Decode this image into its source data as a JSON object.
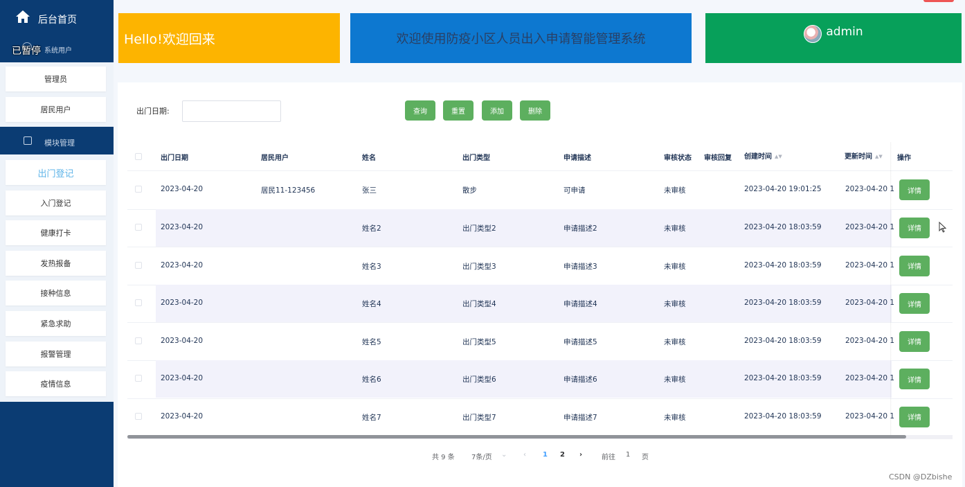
{
  "sidebar": {
    "home_label": "后台首页",
    "paused_label": "已暂停",
    "system_users_label": "系统用户",
    "system_items": [
      "管理员",
      "居民用户"
    ],
    "module_label": "模块管理",
    "module_items": [
      "出门登记",
      "入门登记",
      "健康打卡",
      "发热报备",
      "接种信息",
      "紧急求助",
      "报警管理",
      "疫情信息"
    ],
    "active_item": "出门登记"
  },
  "banners": {
    "welcome": "Hello!欢迎回来",
    "system_title": "欢迎使用防疫小区人员出入申请智能管理系统",
    "user": "admin",
    "colors": {
      "welcome": "#fdb400",
      "title": "#0d78d0",
      "user": "#07a05a"
    }
  },
  "search": {
    "date_label": "出门日期:",
    "date_value": "",
    "buttons": {
      "query": "查询",
      "reset": "重置",
      "add": "添加",
      "delete": "删除"
    }
  },
  "table": {
    "headers": [
      "出门日期",
      "居民用户",
      "姓名",
      "出门类型",
      "申请描述",
      "审核状态",
      "审核回复",
      "创建时间",
      "更新时间",
      "操作"
    ],
    "rows": [
      {
        "date": "2023-04-20",
        "resident": "居民11-123456",
        "name": "张三",
        "type": "散步",
        "desc": "可申请",
        "status": "未审核",
        "reply": "",
        "created": "2023-04-20 19:01:25",
        "updated": "2023-04-20 1"
      },
      {
        "date": "2023-04-20",
        "resident": "",
        "name": "姓名2",
        "type": "出门类型2",
        "desc": "申请描述2",
        "status": "未审核",
        "reply": "",
        "created": "2023-04-20 18:03:59",
        "updated": "2023-04-20 1"
      },
      {
        "date": "2023-04-20",
        "resident": "",
        "name": "姓名3",
        "type": "出门类型3",
        "desc": "申请描述3",
        "status": "未审核",
        "reply": "",
        "created": "2023-04-20 18:03:59",
        "updated": "2023-04-20 1"
      },
      {
        "date": "2023-04-20",
        "resident": "",
        "name": "姓名4",
        "type": "出门类型4",
        "desc": "申请描述4",
        "status": "未审核",
        "reply": "",
        "created": "2023-04-20 18:03:59",
        "updated": "2023-04-20 1"
      },
      {
        "date": "2023-04-20",
        "resident": "",
        "name": "姓名5",
        "type": "出门类型5",
        "desc": "申请描述5",
        "status": "未审核",
        "reply": "",
        "created": "2023-04-20 18:03:59",
        "updated": "2023-04-20 1"
      },
      {
        "date": "2023-04-20",
        "resident": "",
        "name": "姓名6",
        "type": "出门类型6",
        "desc": "申请描述6",
        "status": "未审核",
        "reply": "",
        "created": "2023-04-20 18:03:59",
        "updated": "2023-04-20 1"
      },
      {
        "date": "2023-04-20",
        "resident": "",
        "name": "姓名7",
        "type": "出门类型7",
        "desc": "申请描述7",
        "status": "未审核",
        "reply": "",
        "created": "2023-04-20 18:03:59",
        "updated": "2023-04-20 1"
      }
    ],
    "detail_label": "详情"
  },
  "pagination": {
    "total": "共 9 条",
    "page_size": "7条/页",
    "pages": [
      "1",
      "2"
    ],
    "current": "1",
    "goto_prefix": "前往",
    "goto_value": "1",
    "goto_suffix": "页"
  },
  "watermark": "CSDN @DZbishe"
}
